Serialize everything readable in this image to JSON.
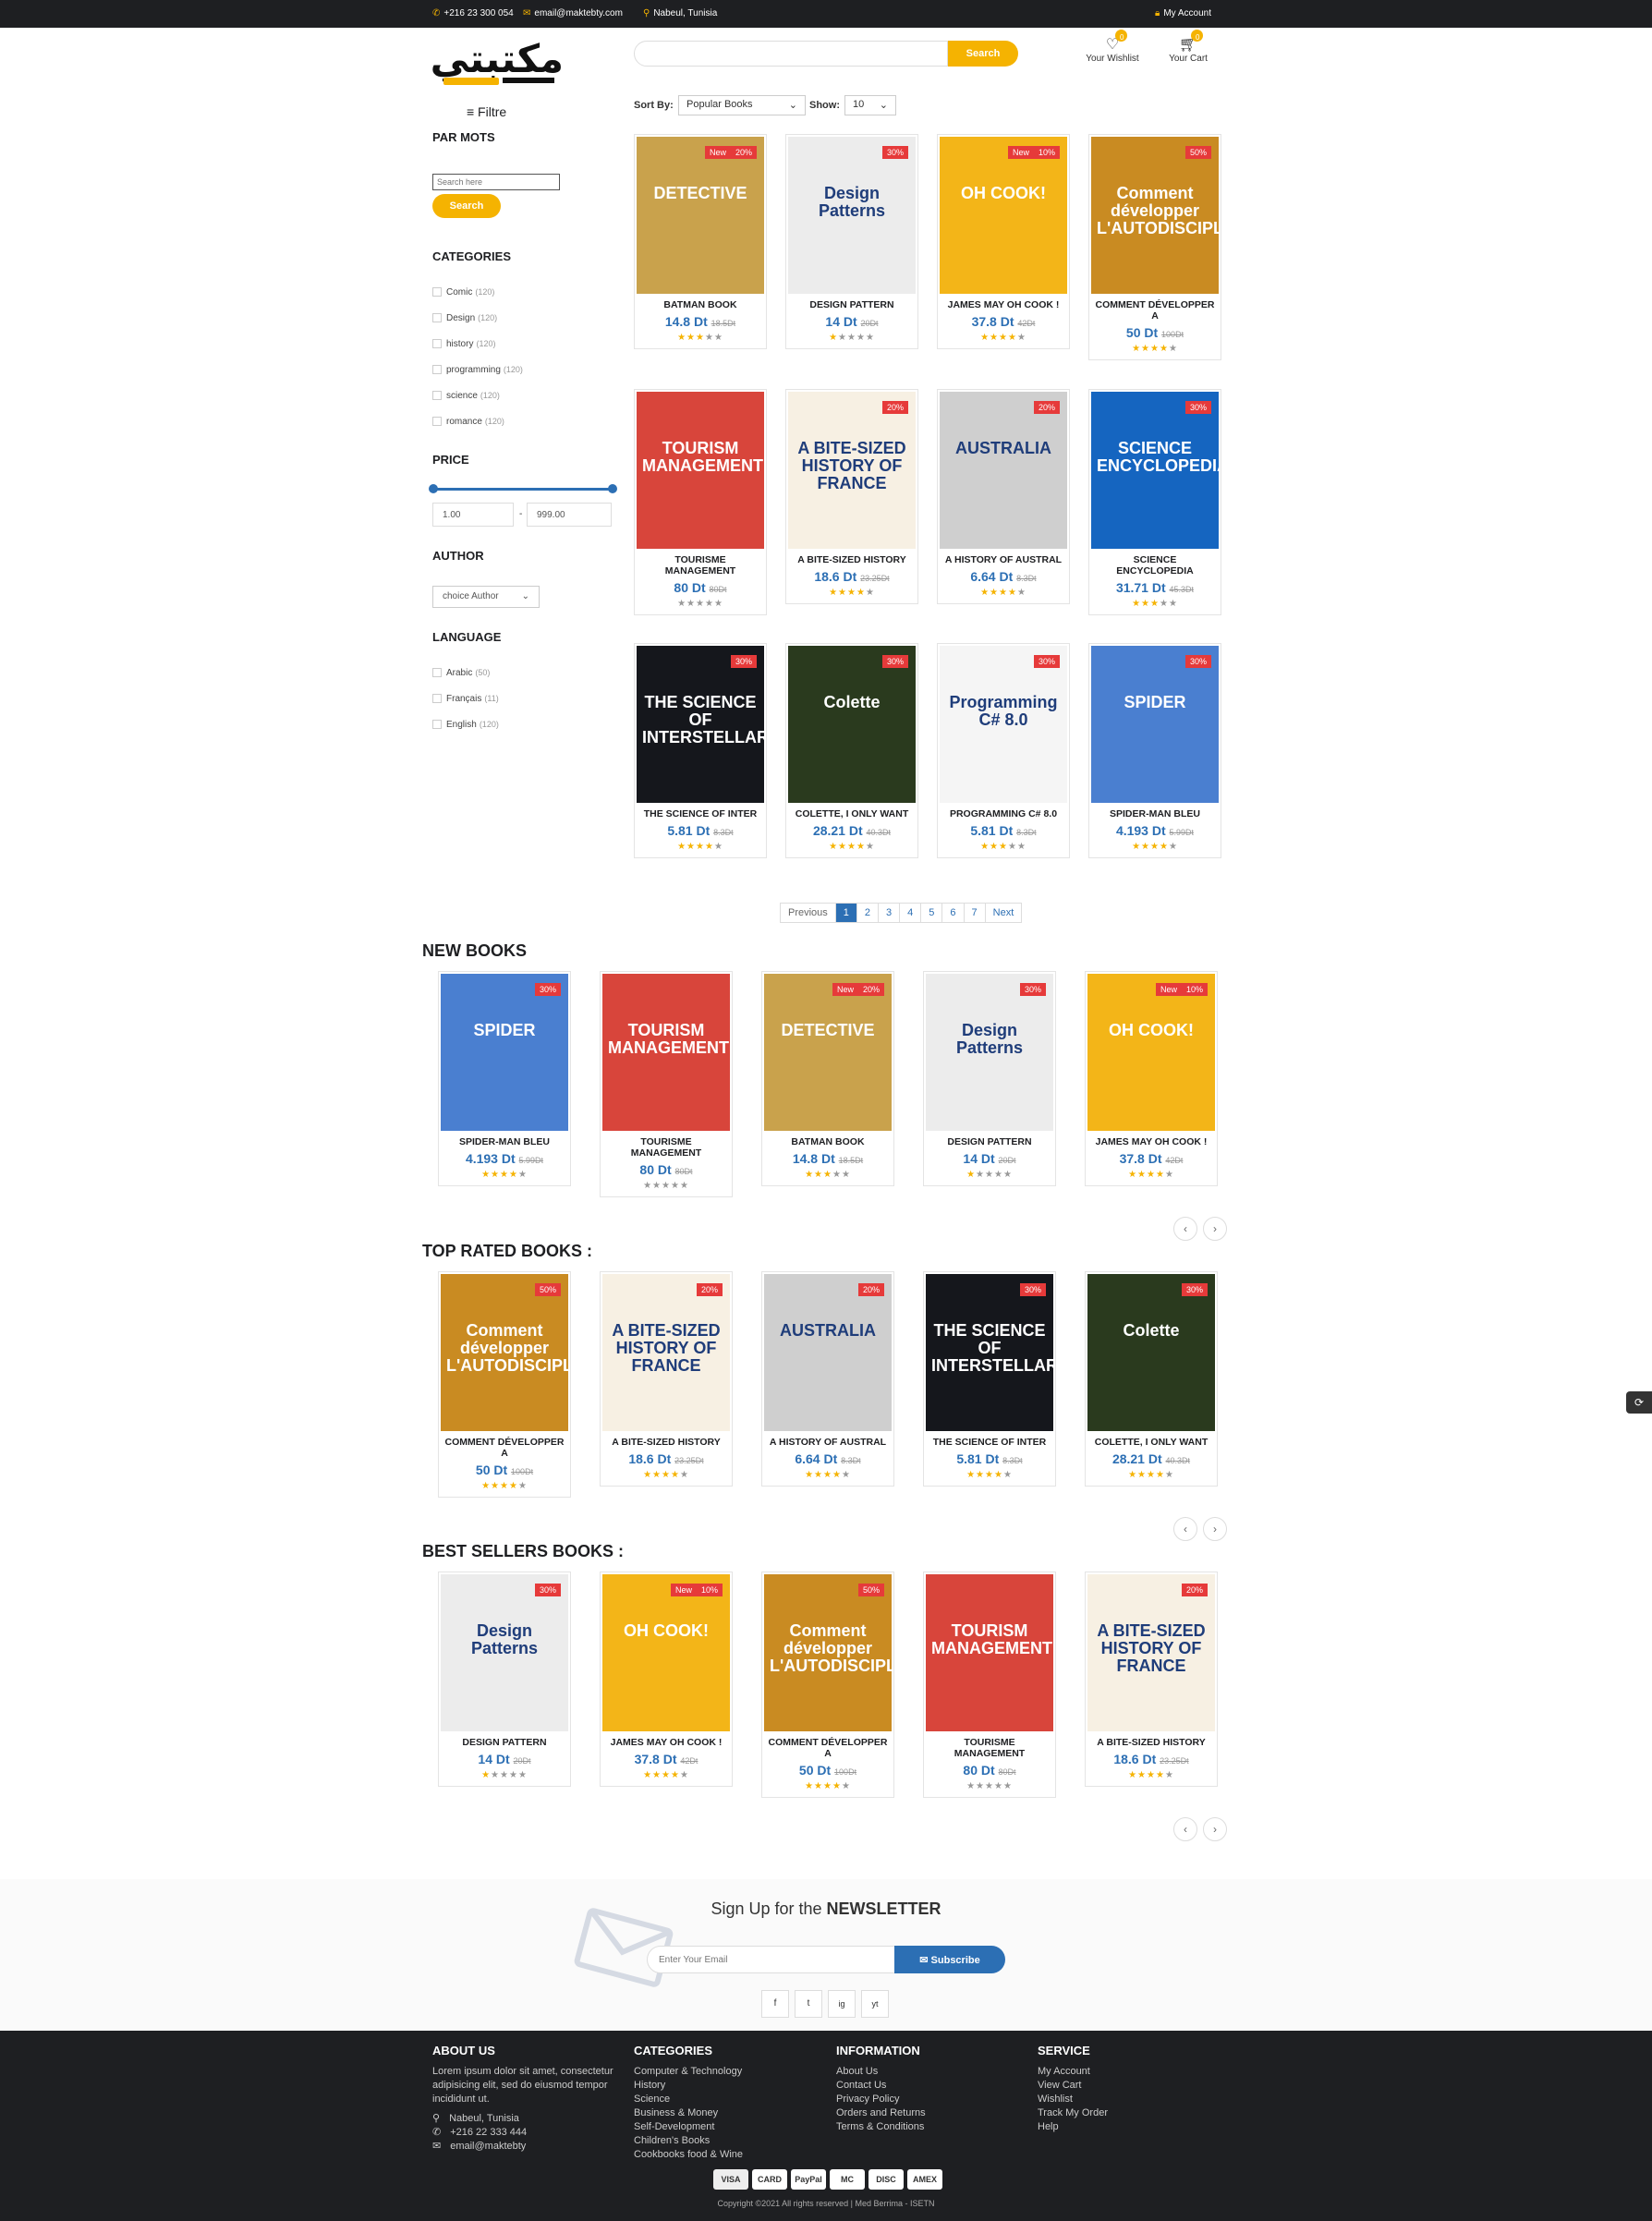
{
  "topbar": {
    "phone": "+216 23 300 054",
    "email": "email@maktebty.com",
    "location": "Nabeul, Tunisia",
    "account": "My Account"
  },
  "header": {
    "logo": "مكتبتي",
    "search_button": "Search",
    "wishlist": "Your Wishlist",
    "wishlist_count": "0",
    "cart": "Your Cart",
    "cart_count": "0"
  },
  "sidebar": {
    "filter": "≡ Filtre",
    "keywords_title": "PAR MOTS",
    "keywords_placeholder": "Search here",
    "keywords_button": "Search",
    "categories_title": "CATEGORIES",
    "categories": [
      {
        "name": "Comic",
        "count": "(120)"
      },
      {
        "name": "Design",
        "count": "(120)"
      },
      {
        "name": "history",
        "count": "(120)"
      },
      {
        "name": "programming",
        "count": "(120)"
      },
      {
        "name": "science",
        "count": "(120)"
      },
      {
        "name": "romance",
        "count": "(120)"
      }
    ],
    "price_title": "PRICE",
    "price_min": "1.00",
    "price_sep": "-",
    "price_max": "999.00",
    "author_title": "AUTHOR",
    "author_select": "choice Author",
    "language_title": "LANGUAGE",
    "languages": [
      {
        "name": "Arabic",
        "count": "(50)"
      },
      {
        "name": "Français",
        "count": "(11)"
      },
      {
        "name": "English",
        "count": "(120)"
      }
    ]
  },
  "sort": {
    "label": "Sort By:",
    "value": "Popular Books",
    "show_label": "Show:",
    "show_value": "10"
  },
  "books": {
    "batman": {
      "name": "BATMAN BOOK",
      "price": "14.8 Dt",
      "old": "18.5Dt",
      "badge": "20%",
      "new": "New",
      "rating": 3,
      "cover": "#c9a24c",
      "title": "DETECTIVE"
    },
    "design": {
      "name": "DESIGN PATTERN",
      "price": "14 Dt",
      "old": "20Dt",
      "badge": "30%",
      "rating": 1,
      "cover": "#ececec",
      "title": "Design Patterns"
    },
    "james": {
      "name": "JAMES MAY OH COOK !",
      "price": "37.8 Dt",
      "old": "42Dt",
      "badge": "10%",
      "new": "New",
      "rating": 4,
      "cover": "#f3b518",
      "title": "OH COOK!"
    },
    "comment": {
      "name": "COMMENT DÉVELOPPER A",
      "price": "50 Dt",
      "old": "100Dt",
      "badge": "50%",
      "rating": 4,
      "cover": "#c98b22",
      "title": "Comment développer L'AUTODISCIPLINE"
    },
    "tourism": {
      "name": "TOURISME MANAGEMENT",
      "price": "80 Dt",
      "old": "80Dt",
      "badge": "",
      "rating": 0,
      "cover": "#d8453b",
      "title": "TOURISM MANAGEMENT"
    },
    "bite": {
      "name": "A BITE-SIZED HISTORY",
      "price": "18.6 Dt",
      "old": "23.25Dt",
      "badge": "20%",
      "rating": 4,
      "cover": "#f7f0e3",
      "title": "A BITE-SIZED HISTORY OF FRANCE"
    },
    "australia": {
      "name": "A HISTORY OF AUSTRAL",
      "price": "6.64 Dt",
      "old": "8.3Dt",
      "badge": "20%",
      "rating": 4,
      "cover": "#cfcfcf",
      "title": "AUSTRALIA"
    },
    "science": {
      "name": "SCIENCE ENCYCLOPEDIA",
      "price": "31.71 Dt",
      "old": "45.3Dt",
      "badge": "30%",
      "rating": 3,
      "cover": "#1565c0",
      "title": "SCIENCE ENCYCLOPEDIA"
    },
    "interstellar": {
      "name": "THE SCIENCE OF INTER",
      "price": "5.81 Dt",
      "old": "8.3Dt",
      "badge": "30%",
      "rating": 4,
      "cover": "#15171c",
      "title": "THE SCIENCE OF INTERSTELLAR"
    },
    "colette": {
      "name": "COLETTE, I ONLY WANT",
      "price": "28.21 Dt",
      "old": "40.3Dt",
      "badge": "30%",
      "rating": 4,
      "cover": "#2a3a1e",
      "title": "Colette"
    },
    "csharp": {
      "name": "PROGRAMMING C# 8.0",
      "price": "5.81 Dt",
      "old": "8.3Dt",
      "badge": "30%",
      "rating": 3,
      "cover": "#f5f5f5",
      "title": "Programming C# 8.0"
    },
    "spider": {
      "name": "SPIDER-MAN BLEU",
      "price": "4.193 Dt",
      "old": "5.99Dt",
      "badge": "30%",
      "rating": 4,
      "cover": "#4a7fd0",
      "title": "SPIDER"
    }
  },
  "pagination": [
    "Previous",
    "1",
    "2",
    "3",
    "4",
    "5",
    "6",
    "7",
    "Next"
  ],
  "sections": {
    "new": "NEW BOOKS",
    "top": "TOP RATED BOOKS :",
    "best": "BEST SELLERS BOOKS :"
  },
  "newsletter": {
    "prefix": "Sign Up for the ",
    "strong": "NEWSLETTER",
    "placeholder": "Enter Your Email",
    "button": "✉ Subscribe",
    "social": [
      "f",
      "t",
      "ig",
      "yt"
    ]
  },
  "footer": {
    "about_title": "ABOUT US",
    "about_text": "Lorem ipsum dolor sit amet, consectetur adipisicing elit, sed do eiusmod tempor incididunt ut.",
    "about_loc": "Nabeul, Tunisia",
    "about_phone": "+216 22 333 444",
    "about_email": "email@maktebty",
    "cat_title": "CATEGORIES",
    "cats": [
      "Computer & Technology",
      "History",
      "Science",
      "Business & Money",
      "Self-Development",
      "Children's Books",
      "Cookbooks food & Wine"
    ],
    "info_title": "INFORMATION",
    "infos": [
      "About Us",
      "Contact Us",
      "Privacy Policy",
      "Orders and Returns",
      "Terms & Conditions"
    ],
    "service_title": "SERVICE",
    "services": [
      "My Account",
      "View Cart",
      "Wishlist",
      "Track My Order",
      "Help"
    ],
    "payments": [
      "VISA",
      "CARD",
      "PayPal",
      "MC",
      "DISC",
      "AMEX"
    ],
    "copyright": "Copyright ©2021 All rights reserved | Med Berrima - ISETN"
  }
}
